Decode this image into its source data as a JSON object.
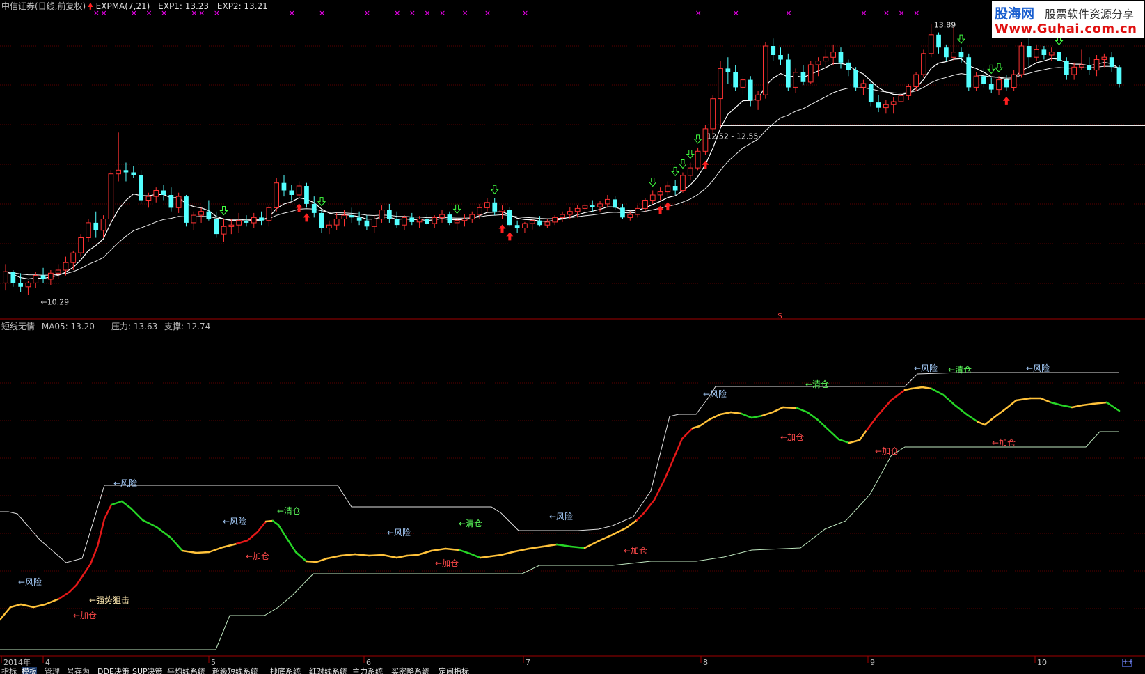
{
  "colors": {
    "up": "#ff3232",
    "down": "#54ffff",
    "panel_border": "#a00000",
    "grid": "#5a0000",
    "text_default": "#c0c0c0",
    "label_white": "#ffffff",
    "label_yellow": "#ffff00",
    "cross_marker": "#ff00ff",
    "arrow_up": "#ff2020",
    "arrow_down": "#40ff40",
    "seg_red": "#e41818",
    "seg_yellow": "#ffc23a",
    "seg_green": "#26d526",
    "text_risk": "#a8d0ff",
    "text_clear": "#5cff5c",
    "text_add": "#ff4a4a",
    "text_strong": "#ffe9b0",
    "line_pressure": "#e0e0e0",
    "line_support": "#c0e8c0"
  },
  "header": {
    "security": "中信证券(日线,前复权)",
    "indicator_name": "EXPMA(7,21)",
    "exp1_label": "EXP1: 13.23",
    "exp2_label": "EXP2: 13.21",
    "icons": {
      "indicator_up_arrow": "arrow-up-icon"
    }
  },
  "logo": {
    "cn_site": "股海网",
    "cn_slogan": "股票软件资源分享",
    "url": "Www.Guhai.com.cn"
  },
  "chart_data": [
    {
      "type": "candlestick",
      "title": "中信证券(日线,前复权)",
      "indicator": "EXPMA(7,21)",
      "series": [
        {
          "name": "EXP1",
          "last": 13.23
        },
        {
          "name": "EXP2",
          "last": 13.21
        }
      ],
      "ylim": [
        10.0,
        14.1
      ],
      "annotations": {
        "low": {
          "value": 10.29,
          "label": "←10.29"
        },
        "high": {
          "value": 13.89,
          "label": "13.89"
        },
        "zone": {
          "label": "12.52 - 12.55",
          "value": 12.54
        }
      },
      "candles_ohlc": [
        [
          10.45,
          10.7,
          10.35,
          10.6
        ],
        [
          10.6,
          10.62,
          10.4,
          10.45
        ],
        [
          10.45,
          10.58,
          10.33,
          10.4
        ],
        [
          10.4,
          10.48,
          10.29,
          10.45
        ],
        [
          10.45,
          10.6,
          10.38,
          10.55
        ],
        [
          10.55,
          10.65,
          10.45,
          10.5
        ],
        [
          10.5,
          10.62,
          10.42,
          10.58
        ],
        [
          10.58,
          10.7,
          10.5,
          10.62
        ],
        [
          10.62,
          10.8,
          10.55,
          10.72
        ],
        [
          10.72,
          10.88,
          10.62,
          10.85
        ],
        [
          10.85,
          11.1,
          10.8,
          11.05
        ],
        [
          11.05,
          11.3,
          11.0,
          11.25
        ],
        [
          11.25,
          11.4,
          11.05,
          11.15
        ],
        [
          11.15,
          11.35,
          11.05,
          11.3
        ],
        [
          11.3,
          11.95,
          11.25,
          11.9
        ],
        [
          11.9,
          12.45,
          11.8,
          11.95
        ],
        [
          11.95,
          12.05,
          11.8,
          11.92
        ],
        [
          11.92,
          12.0,
          11.85,
          11.88
        ],
        [
          11.88,
          11.95,
          11.5,
          11.55
        ],
        [
          11.55,
          11.65,
          11.45,
          11.6
        ],
        [
          11.6,
          11.72,
          11.52,
          11.68
        ],
        [
          11.68,
          11.75,
          11.55,
          11.62
        ],
        [
          11.62,
          11.72,
          11.4,
          11.45
        ],
        [
          11.45,
          11.65,
          11.38,
          11.6
        ],
        [
          11.6,
          11.62,
          11.2,
          11.25
        ],
        [
          11.25,
          11.4,
          11.15,
          11.35
        ],
        [
          11.35,
          11.45,
          11.25,
          11.4
        ],
        [
          11.4,
          11.55,
          11.28,
          11.3
        ],
        [
          11.3,
          11.4,
          11.05,
          11.1
        ],
        [
          11.1,
          11.3,
          11.0,
          11.2
        ],
        [
          11.2,
          11.3,
          11.1,
          11.22
        ],
        [
          11.22,
          11.38,
          11.12,
          11.28
        ],
        [
          11.28,
          11.35,
          11.2,
          11.25
        ],
        [
          11.25,
          11.38,
          11.18,
          11.32
        ],
        [
          11.32,
          11.4,
          11.22,
          11.28
        ],
        [
          11.28,
          11.48,
          11.2,
          11.45
        ],
        [
          11.45,
          11.85,
          11.4,
          11.78
        ],
        [
          11.78,
          11.88,
          11.6,
          11.68
        ],
        [
          11.68,
          11.75,
          11.55,
          11.62
        ],
        [
          11.62,
          11.8,
          11.58,
          11.74
        ],
        [
          11.74,
          11.78,
          11.45,
          11.5
        ],
        [
          11.5,
          11.6,
          11.32,
          11.38
        ],
        [
          11.38,
          11.42,
          11.12,
          11.18
        ],
        [
          11.18,
          11.28,
          11.1,
          11.22
        ],
        [
          11.22,
          11.38,
          11.15,
          11.3
        ],
        [
          11.3,
          11.42,
          11.2,
          11.35
        ],
        [
          11.35,
          11.45,
          11.25,
          11.32
        ],
        [
          11.32,
          11.4,
          11.22,
          11.28
        ],
        [
          11.28,
          11.35,
          11.15,
          11.2
        ],
        [
          11.2,
          11.35,
          11.12,
          11.3
        ],
        [
          11.3,
          11.48,
          11.25,
          11.42
        ],
        [
          11.42,
          11.5,
          11.25,
          11.3
        ],
        [
          11.3,
          11.4,
          11.18,
          11.22
        ],
        [
          11.22,
          11.35,
          11.15,
          11.32
        ],
        [
          11.32,
          11.38,
          11.22,
          11.26
        ],
        [
          11.26,
          11.34,
          11.18,
          11.3
        ],
        [
          11.3,
          11.36,
          11.22,
          11.24
        ],
        [
          11.24,
          11.35,
          11.18,
          11.32
        ],
        [
          11.32,
          11.42,
          11.25,
          11.36
        ],
        [
          11.36,
          11.4,
          11.22,
          11.25
        ],
        [
          11.25,
          11.32,
          11.15,
          11.28
        ],
        [
          11.28,
          11.36,
          11.2,
          11.3
        ],
        [
          11.3,
          11.4,
          11.25,
          11.36
        ],
        [
          11.36,
          11.5,
          11.3,
          11.45
        ],
        [
          11.45,
          11.58,
          11.4,
          11.52
        ],
        [
          11.52,
          11.58,
          11.35,
          11.4
        ],
        [
          11.4,
          11.48,
          11.3,
          11.42
        ],
        [
          11.42,
          11.46,
          11.2,
          11.22
        ],
        [
          11.22,
          11.28,
          11.12,
          11.18
        ],
        [
          11.18,
          11.26,
          11.12,
          11.24
        ],
        [
          11.24,
          11.3,
          11.16,
          11.28
        ],
        [
          11.28,
          11.34,
          11.2,
          11.22
        ],
        [
          11.22,
          11.3,
          11.18,
          11.26
        ],
        [
          11.26,
          11.35,
          11.22,
          11.32
        ],
        [
          11.32,
          11.4,
          11.26,
          11.36
        ],
        [
          11.36,
          11.46,
          11.3,
          11.4
        ],
        [
          11.4,
          11.48,
          11.32,
          11.44
        ],
        [
          11.44,
          11.52,
          11.38,
          11.48
        ],
        [
          11.48,
          11.55,
          11.4,
          11.46
        ],
        [
          11.46,
          11.54,
          11.4,
          11.5
        ],
        [
          11.5,
          11.62,
          11.45,
          11.56
        ],
        [
          11.56,
          11.6,
          11.42,
          11.45
        ],
        [
          11.45,
          11.5,
          11.3,
          11.32
        ],
        [
          11.32,
          11.4,
          11.28,
          11.36
        ],
        [
          11.36,
          11.48,
          11.32,
          11.44
        ],
        [
          11.44,
          11.58,
          11.4,
          11.55
        ],
        [
          11.55,
          11.68,
          11.5,
          11.62
        ],
        [
          11.62,
          11.72,
          11.55,
          11.66
        ],
        [
          11.66,
          11.8,
          11.6,
          11.74
        ],
        [
          11.74,
          11.82,
          11.62,
          11.68
        ],
        [
          11.68,
          11.92,
          11.65,
          11.88
        ],
        [
          11.88,
          12.05,
          11.82,
          11.98
        ],
        [
          11.98,
          12.25,
          11.95,
          12.2
        ],
        [
          12.2,
          12.55,
          12.15,
          12.5
        ],
        [
          12.5,
          12.95,
          12.42,
          12.9
        ],
        [
          12.9,
          13.4,
          12.52,
          13.3
        ],
        [
          13.3,
          13.45,
          13.1,
          13.25
        ],
        [
          13.25,
          13.35,
          13.0,
          13.05
        ],
        [
          13.05,
          13.2,
          12.95,
          13.15
        ],
        [
          13.15,
          13.2,
          12.8,
          12.88
        ],
        [
          12.88,
          13.0,
          12.75,
          12.95
        ],
        [
          12.95,
          13.65,
          12.9,
          13.6
        ],
        [
          13.6,
          13.7,
          13.4,
          13.48
        ],
        [
          13.48,
          13.58,
          13.35,
          13.42
        ],
        [
          13.42,
          13.5,
          13.0,
          13.05
        ],
        [
          13.05,
          13.3,
          12.98,
          13.25
        ],
        [
          13.25,
          13.35,
          13.08,
          13.12
        ],
        [
          13.12,
          13.4,
          13.1,
          13.35
        ],
        [
          13.35,
          13.45,
          13.2,
          13.4
        ],
        [
          13.4,
          13.55,
          13.3,
          13.45
        ],
        [
          13.45,
          13.62,
          13.35,
          13.52
        ],
        [
          13.52,
          13.58,
          13.3,
          13.38
        ],
        [
          13.38,
          13.42,
          13.2,
          13.28
        ],
        [
          13.28,
          13.32,
          13.0,
          13.05
        ],
        [
          13.05,
          13.15,
          12.95,
          13.1
        ],
        [
          13.1,
          13.15,
          12.8,
          12.85
        ],
        [
          12.85,
          12.95,
          12.72,
          12.78
        ],
        [
          12.78,
          12.88,
          12.7,
          12.82
        ],
        [
          12.82,
          12.92,
          12.7,
          12.86
        ],
        [
          12.86,
          12.98,
          12.78,
          12.94
        ],
        [
          12.94,
          13.1,
          12.88,
          13.06
        ],
        [
          13.06,
          13.25,
          13.0,
          13.22
        ],
        [
          13.22,
          13.55,
          13.18,
          13.5
        ],
        [
          13.5,
          13.89,
          13.45,
          13.75
        ],
        [
          13.75,
          13.78,
          13.5,
          13.58
        ],
        [
          13.58,
          13.62,
          13.4,
          13.45
        ],
        [
          13.45,
          13.85,
          13.4,
          13.52
        ],
        [
          13.52,
          13.58,
          13.38,
          13.45
        ],
        [
          13.45,
          13.5,
          13.0,
          13.05
        ],
        [
          13.05,
          13.25,
          13.0,
          13.2
        ],
        [
          13.2,
          13.3,
          13.05,
          13.1
        ],
        [
          13.1,
          13.18,
          12.98,
          13.02
        ],
        [
          13.02,
          13.2,
          12.95,
          13.15
        ],
        [
          13.15,
          13.22,
          13.0,
          13.05
        ],
        [
          13.05,
          13.28,
          13.0,
          13.22
        ],
        [
          13.22,
          13.65,
          13.18,
          13.6
        ],
        [
          13.6,
          13.75,
          13.3,
          13.45
        ],
        [
          13.45,
          13.62,
          13.4,
          13.55
        ],
        [
          13.55,
          13.6,
          13.42,
          13.48
        ],
        [
          13.48,
          13.58,
          13.4,
          13.52
        ],
        [
          13.52,
          13.56,
          13.35,
          13.4
        ],
        [
          13.4,
          13.45,
          13.15,
          13.22
        ],
        [
          13.22,
          13.38,
          13.15,
          13.32
        ],
        [
          13.32,
          13.55,
          13.28,
          13.35
        ],
        [
          13.35,
          13.45,
          13.22,
          13.28
        ],
        [
          13.28,
          13.48,
          13.2,
          13.42
        ],
        [
          13.42,
          13.5,
          13.32,
          13.45
        ],
        [
          13.45,
          13.52,
          13.25,
          13.32
        ],
        [
          13.32,
          13.35,
          13.05,
          13.1
        ]
      ],
      "buy_arrow_indices": [
        39,
        40,
        66,
        67,
        87,
        88,
        93,
        133
      ],
      "sell_arrow_indices": [
        29,
        42,
        60,
        65,
        86,
        89,
        90,
        91,
        92,
        127,
        131,
        132,
        140
      ],
      "cross_marker_indices": [
        12,
        13,
        17,
        19,
        21,
        25,
        26,
        28,
        38,
        42,
        48,
        52,
        54,
        56,
        58,
        61,
        64,
        69,
        92,
        97,
        104,
        114,
        117,
        119,
        121
      ]
    },
    {
      "type": "line",
      "title": "短线无情",
      "legend": [
        "MA05: 13.20",
        "压力: 13.63",
        "支撑: 12.74"
      ],
      "series": [
        {
          "name": "MA05",
          "last": 13.2
        },
        {
          "name": "压力",
          "last": 13.63
        },
        {
          "name": "支撑",
          "last": 12.74
        }
      ]
    }
  ],
  "upper_labels": {
    "low_label": "←10.29",
    "high_label": "13.89",
    "zone_label": "12.52 - 12.55",
    "dollar_marker": "$"
  },
  "lower_panel": {
    "indicator": "短线无情",
    "ma05_label": "MA05: 13.20",
    "pressure_label": "压力: 13.63",
    "support_label": "支撑: 12.74",
    "signals": [
      {
        "text": "←风险",
        "kind": "risk"
      },
      {
        "text": "←强势狙击",
        "kind": "strong"
      },
      {
        "text": "←加仓",
        "kind": "add"
      },
      {
        "text": "←风险",
        "kind": "risk"
      },
      {
        "text": "←风险",
        "kind": "risk"
      },
      {
        "text": "←清仓",
        "kind": "clear"
      },
      {
        "text": "←加仓",
        "kind": "add"
      },
      {
        "text": "←风险",
        "kind": "risk"
      },
      {
        "text": "←加仓",
        "kind": "add"
      },
      {
        "text": "←清仓",
        "kind": "clear"
      },
      {
        "text": "←风险",
        "kind": "risk"
      },
      {
        "text": "←加仓",
        "kind": "add"
      },
      {
        "text": "←风险",
        "kind": "risk"
      },
      {
        "text": "←清仓",
        "kind": "clear"
      },
      {
        "text": "←加仓",
        "kind": "add"
      },
      {
        "text": "←风险",
        "kind": "risk"
      },
      {
        "text": "←清仓",
        "kind": "clear"
      },
      {
        "text": "←加仓",
        "kind": "add"
      },
      {
        "text": "←风险",
        "kind": "risk"
      },
      {
        "text": "←加仓",
        "kind": "add"
      }
    ]
  },
  "time_axis": {
    "labels": [
      "2014年",
      "4",
      "5",
      "6",
      "7",
      "8",
      "9",
      "10"
    ]
  },
  "bottom_tabs": [
    "指标",
    "模板",
    "管理",
    "号存为",
    "DDE决策",
    "SUP决策",
    "平均线系统",
    "超级短线系统",
    "抄底系统",
    "红对线系统",
    "主力系统",
    "买密略系统",
    "定间指标"
  ],
  "corner_box": "++"
}
